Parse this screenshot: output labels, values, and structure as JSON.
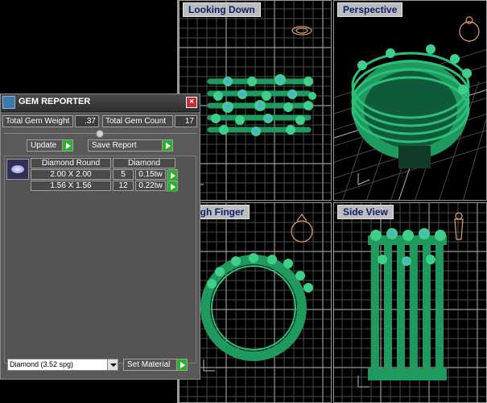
{
  "viewports": {
    "top": "Looking Down",
    "perspective": "Perspective",
    "front": "ough Finger",
    "side": "Side View"
  },
  "gem_reporter": {
    "title": "GEM REPORTER",
    "close_icon": "close-icon",
    "total_weight_label": "Total Gem Weight",
    "total_weight_value": ".37",
    "total_count_label": "Total Gem Count",
    "total_count_value": "17",
    "update_label": "Update",
    "save_report_label": "Save Report",
    "headers": {
      "cut": "Diamond Round",
      "material": "Diamond"
    },
    "rows": [
      {
        "size": "2.00 X 2.00",
        "count": "5",
        "weight": "0.15tw"
      },
      {
        "size": "1.56 X 1.56",
        "count": "12",
        "weight": "0.22tw"
      }
    ],
    "material_select": "Diamond     (3.52 spg)",
    "set_material_label": "Set Material"
  },
  "colors": {
    "model": "#1e9a5e",
    "gem": "#5aa6e6",
    "grid": "#5a5a5a",
    "axis": "#c0c0c0"
  }
}
